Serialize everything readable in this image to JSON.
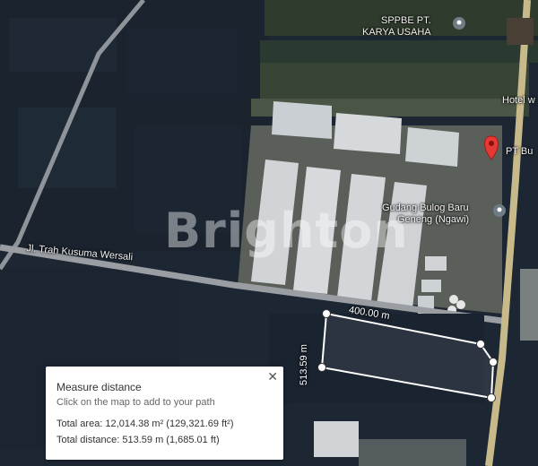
{
  "watermark": "Brighton",
  "pois": {
    "sppbe": "SPPBE PT.",
    "karya": "KARYA USAHA",
    "hotel": "Hotel w",
    "pt_bu": "PT Bu",
    "gudang_line1": "Gudang Bulog Baru",
    "gudang_line2": "Geneng (Ngawi)"
  },
  "road_label": "Jl. Trah Kusuma Wersali",
  "measurement": {
    "segment_top": "400.00 m",
    "segment_left": "513.59 m"
  },
  "measure_panel": {
    "title": "Measure distance",
    "hint": "Click on the map to add to your path",
    "total_area": "Total area: 12,014.38 m² (129,321.69 ft²)",
    "total_distance": "Total distance: 513.59 m (1,685.01 ft)",
    "close_icon": "close-icon"
  },
  "colors": {
    "marker": "#e53935",
    "measure_line": "#ffffff",
    "panel_bg": "#ffffff"
  }
}
